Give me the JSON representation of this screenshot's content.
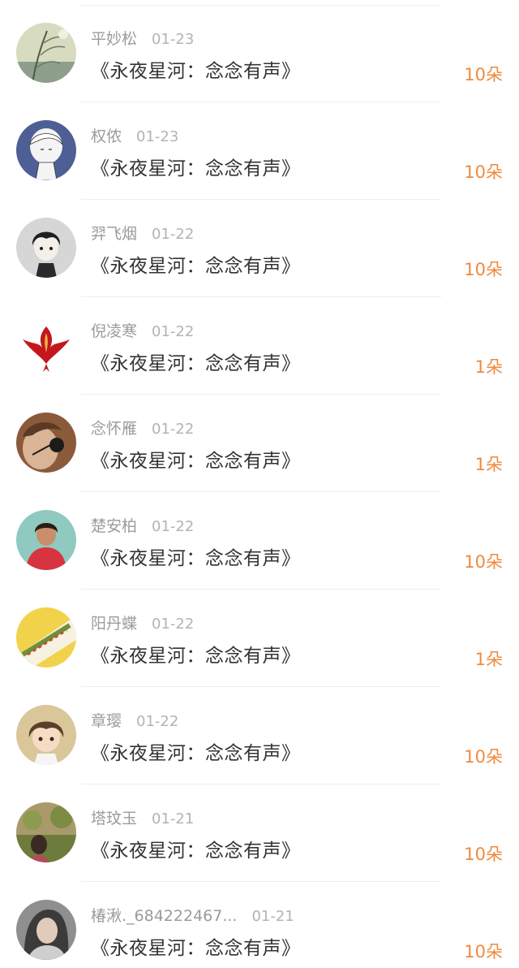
{
  "items": [
    {
      "name": "平妙松",
      "date": "01-23",
      "title": "《永夜星河：念念有声》",
      "amount": "10朵",
      "avatar_icon": "willow-landscape-avatar",
      "colors": [
        "#c9cfa8",
        "#6c7a68"
      ]
    },
    {
      "name": "权侬",
      "date": "01-23",
      "title": "《永夜星河：念念有声》",
      "amount": "10朵",
      "avatar_icon": "anime-white-hair-avatar",
      "colors": [
        "#4d5f95",
        "#f4f4f4"
      ]
    },
    {
      "name": "羿飞烟",
      "date": "01-22",
      "title": "《永夜星河：念念有声》",
      "amount": "10朵",
      "avatar_icon": "anime-dark-hair-avatar",
      "colors": [
        "#d6d6d6",
        "#1e1e1e"
      ]
    },
    {
      "name": "倪凌寒",
      "date": "01-22",
      "title": "《永夜星河：念念有声》",
      "amount": "1朵",
      "avatar_icon": "red-phoenix-emblem-avatar",
      "colors": [
        "#ffffff",
        "#c4161c"
      ]
    },
    {
      "name": "念怀雁",
      "date": "01-22",
      "title": "《永夜星河：念念有声》",
      "amount": "1朵",
      "avatar_icon": "child-with-flower-avatar",
      "colors": [
        "#8a5a3a",
        "#d9b497"
      ]
    },
    {
      "name": "楚安柏",
      "date": "01-22",
      "title": "《永夜星河：念念有声》",
      "amount": "10朵",
      "avatar_icon": "woman-red-dress-avatar",
      "colors": [
        "#8fc9c0",
        "#d8343f"
      ]
    },
    {
      "name": "阳丹蝶",
      "date": "01-22",
      "title": "《永夜星河：念念有声》",
      "amount": "1朵",
      "avatar_icon": "food-dish-avatar",
      "colors": [
        "#f1d24b",
        "#6f8f3a"
      ]
    },
    {
      "name": "章璎",
      "date": "01-22",
      "title": "《永夜星河：念念有声》",
      "amount": "10朵",
      "avatar_icon": "anime-boy-avatar",
      "colors": [
        "#d9c79a",
        "#5a3f2a"
      ]
    },
    {
      "name": "塔玟玉",
      "date": "01-21",
      "title": "《永夜星河：念念有声》",
      "amount": "10朵",
      "avatar_icon": "garden-photo-avatar",
      "colors": [
        "#6d7b3d",
        "#b44a5c"
      ]
    },
    {
      "name": "椿湫._684222467...",
      "date": "01-21",
      "title": "《永夜星河：念念有声》",
      "amount": "10朵",
      "avatar_icon": "woman-portrait-avatar",
      "colors": [
        "#8f8f8f",
        "#3b3b3b"
      ]
    }
  ],
  "accent_color": "#ef8a3e"
}
